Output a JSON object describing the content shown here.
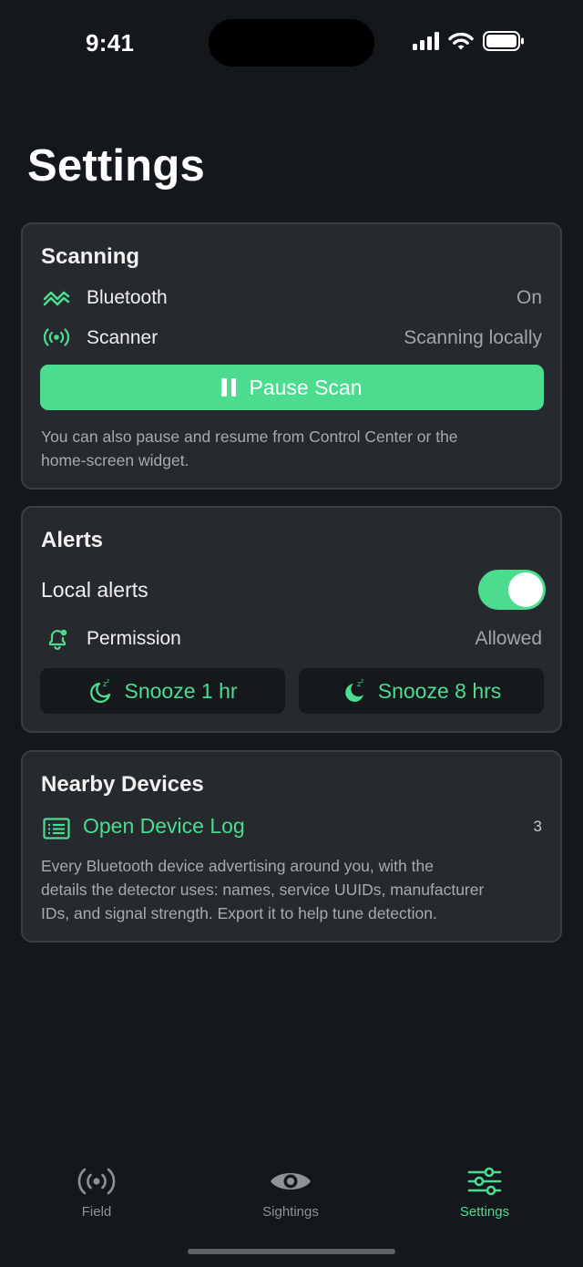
{
  "status_bar": {
    "time": "9:41"
  },
  "page": {
    "title": "Settings"
  },
  "scanning": {
    "title": "Scanning",
    "bluetooth_label": "Bluetooth",
    "bluetooth_value": "On",
    "scanner_label": "Scanner",
    "scanner_value": "Scanning locally",
    "pause_button": "Pause Scan",
    "help_line1": "You can also pause and resume from Control Center or the",
    "help_line2": "home-screen widget."
  },
  "alerts": {
    "title": "Alerts",
    "local_alerts_label": "Local alerts",
    "local_alerts_enabled": true,
    "permission_label": "Permission",
    "permission_value": "Allowed",
    "snooze_1": "Snooze 1 hr",
    "snooze_2": "Snooze 8 hrs"
  },
  "nearby": {
    "title": "Nearby Devices",
    "open_log": "Open Device Log",
    "count": "3",
    "desc_line1": "Every Bluetooth device advertising around you, with the",
    "desc_line2": "details the detector uses: names, service UUIDs, manufacturer",
    "desc_line3": "IDs, and signal strength. Export it to help tune detection."
  },
  "tabs": [
    {
      "label": "Field",
      "icon": "broadcast-icon"
    },
    {
      "label": "Sightings",
      "icon": "eye-icon"
    },
    {
      "label": "Settings",
      "icon": "sliders-icon",
      "active": true
    }
  ],
  "colors": {
    "accent": "#4cdc90",
    "background": "#14181d",
    "card": "#26292d",
    "inactive": "#8e9196"
  }
}
